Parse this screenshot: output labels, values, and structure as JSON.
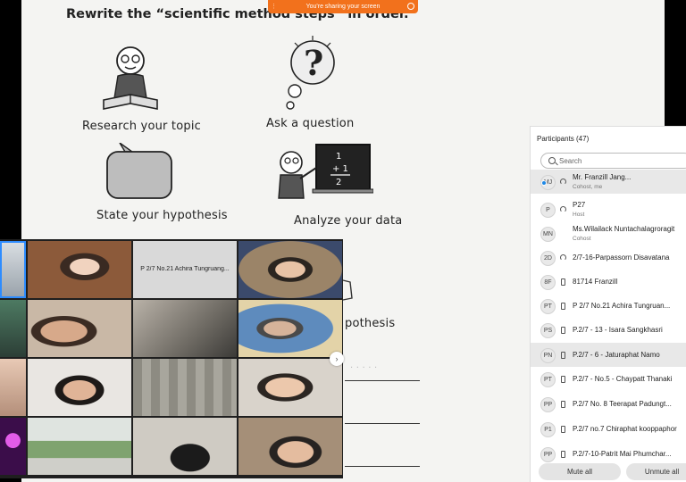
{
  "share_banner": {
    "text": "You're sharing your screen"
  },
  "worksheet": {
    "title": "Rewrite the “scientific method steps” in order.",
    "steps": [
      "Research your topic",
      "Ask a question",
      "State your hypothesis",
      "Analyze your data",
      "pothesis"
    ]
  },
  "gallery": {
    "name_tile": "P 2/7 No.21 Achira Tungruang..."
  },
  "participants": {
    "title": "Participants (47)",
    "search_placeholder": "Search",
    "rows": [
      {
        "initials": "MJ",
        "name": "Mr. Franzill Jang...",
        "role": "Cohost, me",
        "device": "headset"
      },
      {
        "initials": "P",
        "name": "P27",
        "role": "Host",
        "device": "headset"
      },
      {
        "initials": "MN",
        "name": "Ms.Wilailack Nuntachalagroragit",
        "role": "Cohost",
        "device": "none"
      },
      {
        "initials": "2D",
        "name": "2/7-16-Parpassorn Disavatana",
        "role": "",
        "device": "headset"
      },
      {
        "initials": "8F",
        "name": "81714 Franzill",
        "role": "",
        "device": "phone"
      },
      {
        "initials": "PT",
        "name": "P 2/7 No.21 Achira Tungruan...",
        "role": "",
        "device": "phone"
      },
      {
        "initials": "PS",
        "name": "P.2/7 - 13 - Isara Sangkhasri",
        "role": "",
        "device": "phone"
      },
      {
        "initials": "PN",
        "name": "P.2/7 - 6 - Jaturaphat Namo",
        "role": "",
        "device": "phone"
      },
      {
        "initials": "PT",
        "name": "P.2/7 - No.5 - Chaypatt Thanaki",
        "role": "",
        "device": "phone"
      },
      {
        "initials": "PP",
        "name": "P.2/7 No. 8 Teerapat Padungt...",
        "role": "",
        "device": "phone"
      },
      {
        "initials": "P1",
        "name": "P.2/7 no.7 Chiraphat kooppaphor",
        "role": "",
        "device": "phone"
      },
      {
        "initials": "PP",
        "name": "P.2/7-10-Patrit Mai Phumchar...",
        "role": "",
        "device": "phone"
      }
    ],
    "mute_all": "Mute all",
    "unmute_all": "Unmute all"
  }
}
